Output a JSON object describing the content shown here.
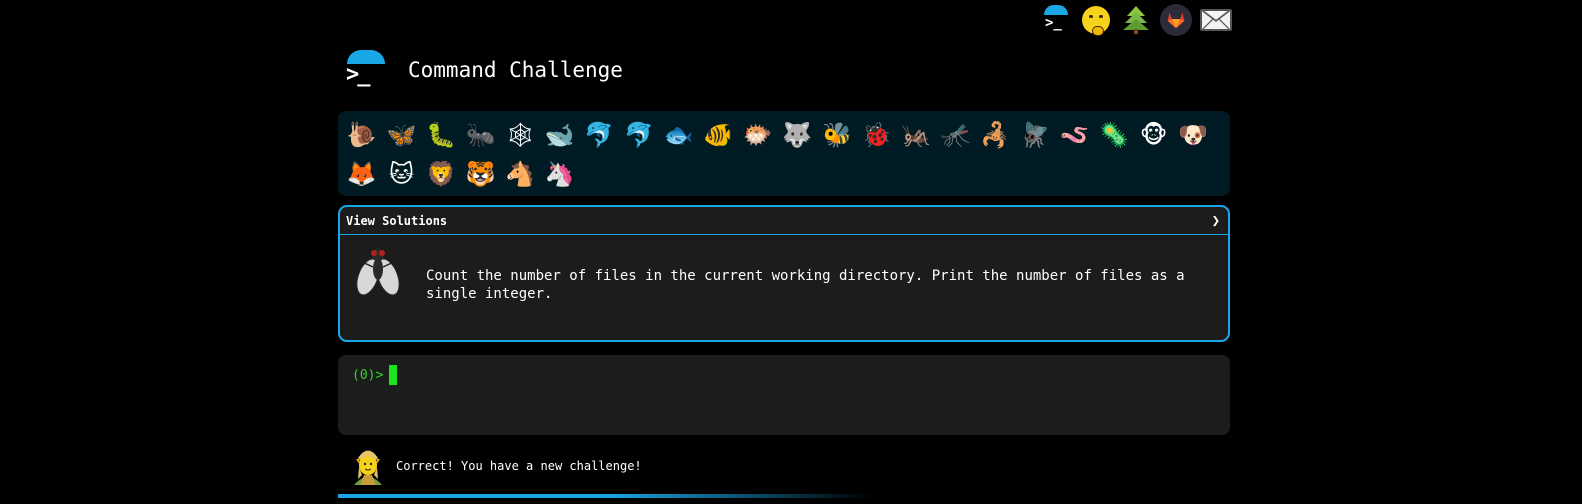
{
  "top_links": [
    {
      "name": "commandchallenge-link-icon",
      "glyph": ">_"
    },
    {
      "name": "shushing-face-icon"
    },
    {
      "name": "tree-icon"
    },
    {
      "name": "gitlab-icon"
    },
    {
      "name": "envelope-icon"
    }
  ],
  "header": {
    "logo_glyph": ">_",
    "title": "Command Challenge"
  },
  "animals": [
    {
      "name": "snail-icon",
      "glyph": "🐌"
    },
    {
      "name": "butterfly-icon",
      "glyph": "🦋"
    },
    {
      "name": "caterpillar-icon",
      "glyph": "🐛"
    },
    {
      "name": "ant-icon",
      "glyph": "🐜"
    },
    {
      "name": "spider-web-icon",
      "glyph": "🕸"
    },
    {
      "name": "whale-icon",
      "glyph": "🐋"
    },
    {
      "name": "dolphin-icon",
      "glyph": "🐬"
    },
    {
      "name": "shark-icon",
      "glyph": "🐬"
    },
    {
      "name": "fish-icon",
      "glyph": "🐟"
    },
    {
      "name": "tropical-fish-icon",
      "glyph": "🐠"
    },
    {
      "name": "blowfish-icon",
      "glyph": "🐡"
    },
    {
      "name": "wolf-icon",
      "glyph": "🐺"
    },
    {
      "name": "bee-icon",
      "glyph": "🐝"
    },
    {
      "name": "ladybug-icon",
      "glyph": "🐞"
    },
    {
      "name": "cricket-icon",
      "glyph": "🦗"
    },
    {
      "name": "mosquito-icon",
      "glyph": "🦟"
    },
    {
      "name": "scorpion-icon",
      "glyph": "🦂"
    },
    {
      "name": "fly-icon",
      "glyph": "🪰"
    },
    {
      "name": "worm-icon",
      "glyph": "🪱"
    },
    {
      "name": "microbe-icon",
      "glyph": "🦠"
    },
    {
      "name": "monkey-icon",
      "glyph": "🐵"
    },
    {
      "name": "dog-icon",
      "glyph": "🐶"
    },
    {
      "name": "fox-icon",
      "glyph": "🦊"
    },
    {
      "name": "cat-icon",
      "glyph": "🐱"
    },
    {
      "name": "lion-icon",
      "glyph": "🦁"
    },
    {
      "name": "tiger-icon",
      "glyph": "🐯"
    },
    {
      "name": "horse-icon",
      "glyph": "🐴"
    },
    {
      "name": "unicorn-icon",
      "glyph": "🦄"
    }
  ],
  "solutions": {
    "label": "View Solutions",
    "chevron": "❯",
    "challenge_icon": "fly-icon",
    "challenge_text": "Count the number of files in the current working directory. Print the number of files as a single integer."
  },
  "terminal": {
    "prompt": "(0)>",
    "input_value": ""
  },
  "status": {
    "avatar_icon": "elf-icon",
    "message": "Correct! You have a new challenge!"
  },
  "colors": {
    "accent": "#1aa7e6",
    "prompt_green": "#2fd52f",
    "panel_bg": "#1c1c1c",
    "animals_bg": "#001b23"
  }
}
